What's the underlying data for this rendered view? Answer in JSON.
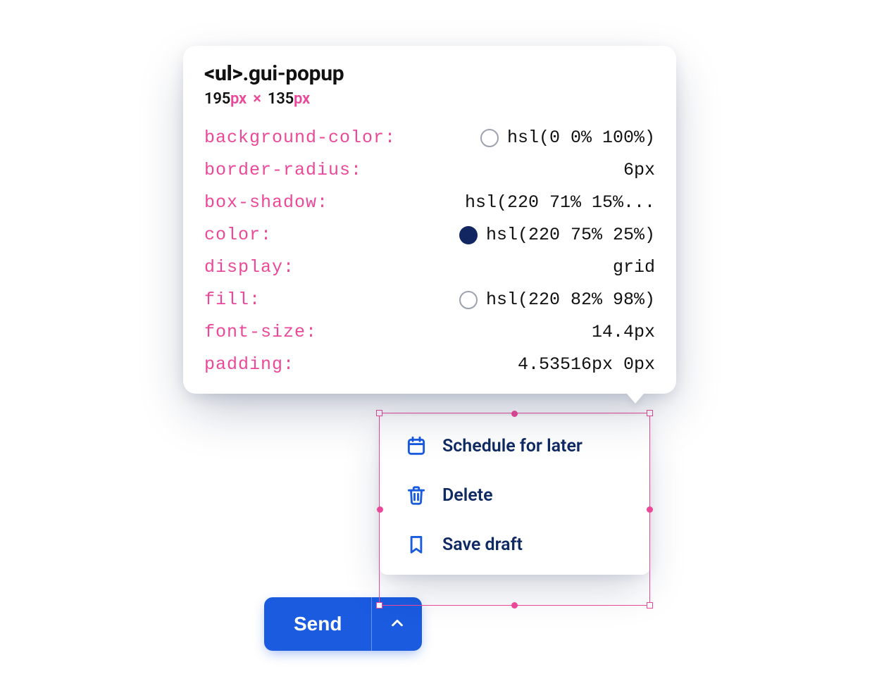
{
  "tooltip": {
    "selector_tag": "<ul>",
    "selector_class": ".gui-popup",
    "width_num": "195",
    "height_num": "135",
    "px_unit": "px",
    "times_glyph": "×",
    "props": [
      {
        "name": "background-color",
        "value": "hsl(0 0% 100%)",
        "swatch": "outline"
      },
      {
        "name": "border-radius",
        "value": "6px"
      },
      {
        "name": "box-shadow",
        "value": "hsl(220 71% 15%..."
      },
      {
        "name": "color",
        "value": "hsl(220 75% 25%)",
        "swatch": "navy"
      },
      {
        "name": "display",
        "value": "grid"
      },
      {
        "name": "fill",
        "value": "hsl(220 82% 98%)",
        "swatch": "outline"
      },
      {
        "name": "font-size",
        "value": "14.4px"
      },
      {
        "name": "padding",
        "value": "4.53516px 0px"
      }
    ]
  },
  "popup": {
    "items": [
      {
        "icon": "calendar-icon",
        "label": "Schedule for later"
      },
      {
        "icon": "trash-icon",
        "label": "Delete"
      },
      {
        "icon": "bookmark-icon",
        "label": "Save draft"
      }
    ]
  },
  "button": {
    "send_label": "Send"
  }
}
